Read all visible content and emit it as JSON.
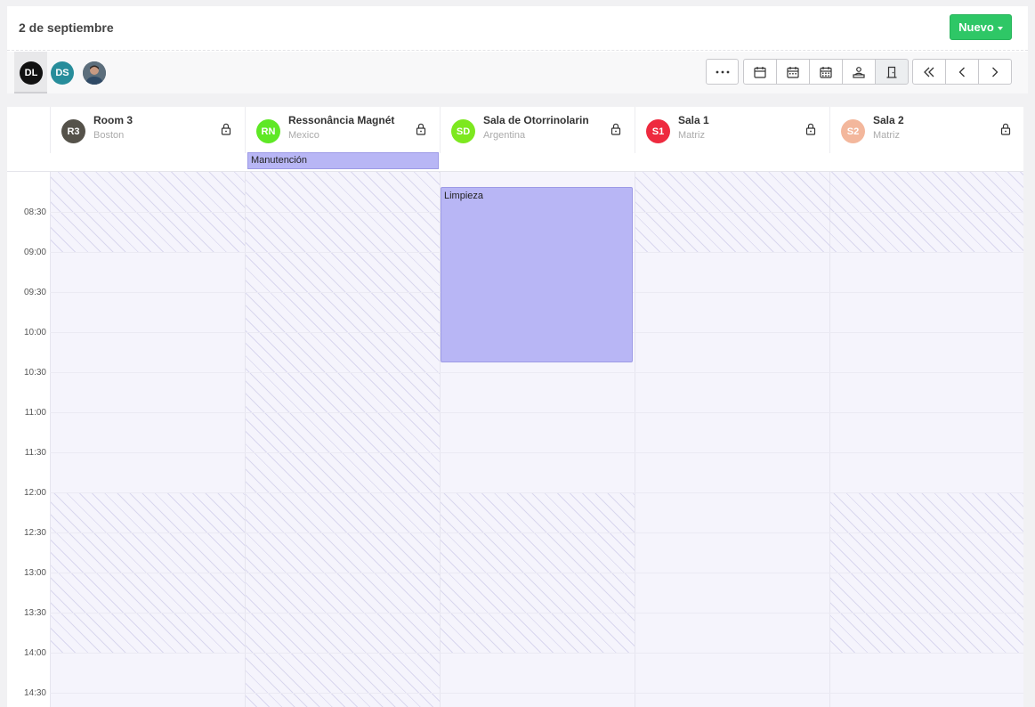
{
  "header": {
    "date_title": "2 de septiembre",
    "new_button_label": "Nuevo"
  },
  "users": [
    {
      "initials": "DL",
      "color": "#111111"
    },
    {
      "initials": "DS",
      "color": "#278d9b"
    },
    {
      "initials": "",
      "kind": "photo"
    }
  ],
  "toolbar": {
    "more_label": "···",
    "buttons": [
      "more-icon",
      "calendar-day-icon",
      "calendar-week-icon",
      "calendar-month-icon",
      "users-icon",
      "door-icon",
      "double-chevron-left-icon",
      "chevron-left-icon",
      "chevron-right-icon"
    ],
    "active": "door-icon"
  },
  "resources": [
    {
      "initials": "R3",
      "name": "Room 3",
      "location": "Boston",
      "color": "#55524a"
    },
    {
      "initials": "RN",
      "name": "Ressonância Magnét",
      "location": "Mexico",
      "color": "#5ee825"
    },
    {
      "initials": "SD",
      "name": "Sala de Otorrinolarin",
      "location": "Argentina",
      "color": "#7de81f"
    },
    {
      "initials": "S1",
      "name": "Sala 1",
      "location": "Matriz",
      "color": "#ee2a3f"
    },
    {
      "initials": "S2",
      "name": "Sala 2",
      "location": "Matriz",
      "color": "#f3b79c"
    }
  ],
  "allday_events": [
    {
      "title": "Manutención",
      "resource": "RN"
    }
  ],
  "events": [
    {
      "title": "Limpieza",
      "resource": "SD",
      "start": "08:15",
      "end": "10:30"
    }
  ],
  "time_labels": [
    "08:30",
    "09:00",
    "09:30",
    "10:00",
    "10:30",
    "11:00",
    "11:30",
    "12:00",
    "12:30",
    "13:00",
    "13:30",
    "14:00",
    "14:30"
  ],
  "colors": {
    "accent_green": "#2ec766",
    "event_fill": "#b8b6f5",
    "event_border": "#9d9ae6"
  }
}
